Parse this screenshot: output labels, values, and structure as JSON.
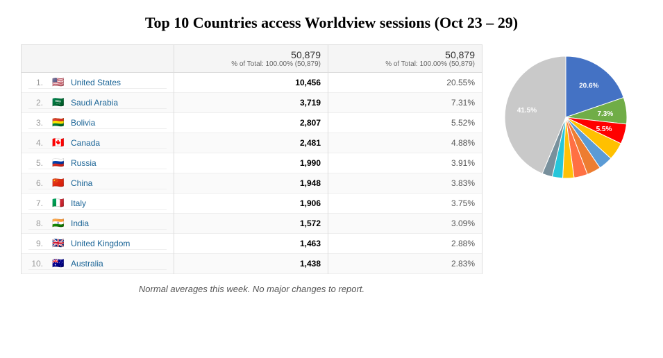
{
  "page": {
    "title": "Top 10 Countries access Worldview sessions (Oct 23 – 29)",
    "note": "Normal averages this week.  No major changes to report."
  },
  "header": {
    "col1_num": "50,879",
    "col1_sub": "% of Total: 100.00% (50,879)",
    "col2_num": "50,879",
    "col2_sub": "% of Total: 100.00% (50,879)"
  },
  "rows": [
    {
      "rank": "1.",
      "country": "United States",
      "value": "10,456",
      "pct": "20.55%",
      "flag": "🇺🇸",
      "color": "#4472C4"
    },
    {
      "rank": "2.",
      "country": "Saudi Arabia",
      "value": "3,719",
      "pct": "7.31%",
      "flag": "🇸🇦",
      "color": "#70AD47"
    },
    {
      "rank": "3.",
      "country": "Bolivia",
      "value": "2,807",
      "pct": "5.52%",
      "flag": "🇧🇴",
      "color": "#FF0000"
    },
    {
      "rank": "4.",
      "country": "Canada",
      "value": "2,481",
      "pct": "4.88%",
      "flag": "🇨🇦",
      "color": "#FFC000"
    },
    {
      "rank": "5.",
      "country": "Russia",
      "value": "1,990",
      "pct": "3.91%",
      "flag": "🇷🇺",
      "color": "#4472C4"
    },
    {
      "rank": "6.",
      "country": "China",
      "value": "1,948",
      "pct": "3.83%",
      "flag": "🇨🇳",
      "color": "#FF0000"
    },
    {
      "rank": "7.",
      "country": "Italy",
      "value": "1,906",
      "pct": "3.75%",
      "flag": "🇮🇹",
      "color": "#FF7043"
    },
    {
      "rank": "8.",
      "country": "India",
      "value": "1,572",
      "pct": "3.09%",
      "flag": "🇮🇳",
      "color": "#FFC107"
    },
    {
      "rank": "9.",
      "country": "United Kingdom",
      "value": "1,463",
      "pct": "2.88%",
      "flag": "🇬🇧",
      "color": "#26C6DA"
    },
    {
      "rank": "10.",
      "country": "Australia",
      "value": "1,438",
      "pct": "2.83%",
      "flag": "🇦🇺",
      "color": "#78909C"
    }
  ],
  "pie": {
    "segments": [
      {
        "label": "20.6%",
        "color": "#4472C4",
        "pct": 20.55
      },
      {
        "label": "7.3%",
        "color": "#70AD47",
        "pct": 7.31
      },
      {
        "label": "5.5%",
        "color": "#FF0000",
        "pct": 5.52
      },
      {
        "label": "",
        "color": "#FFC000",
        "pct": 4.88
      },
      {
        "label": "",
        "color": "#5B9BD5",
        "pct": 3.91
      },
      {
        "label": "",
        "color": "#ED7D31",
        "pct": 3.83
      },
      {
        "label": "",
        "color": "#FF7043",
        "pct": 3.75
      },
      {
        "label": "",
        "color": "#FFC107",
        "pct": 3.09
      },
      {
        "label": "",
        "color": "#26C6DA",
        "pct": 2.88
      },
      {
        "label": "",
        "color": "#78909C",
        "pct": 2.83
      },
      {
        "label": "41.5%",
        "color": "#C9C9C9",
        "pct": 45.44
      }
    ]
  }
}
